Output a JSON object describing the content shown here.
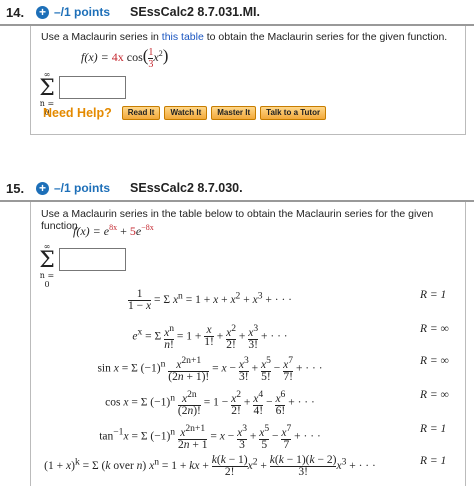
{
  "q14": {
    "number": "14.",
    "points": "–/1 points",
    "id": "SEssCalc2 8.7.031.MI.",
    "prompt_before": "Use a Maclaurin series in ",
    "prompt_link": "this table",
    "prompt_after": " to obtain the Maclaurin series for the given function.",
    "func_lhs": "f(x) = ",
    "func_red": "4x",
    "func_rest": " cos",
    "frac_num": "1",
    "frac_den": "3",
    "exp_var": "x",
    "exp_pow": "2",
    "sum_top": "∞",
    "sum_sym": "Σ",
    "sum_bottom": "n = 0",
    "need_help": "Need Help?",
    "buttons": [
      "Read It",
      "Watch It",
      "Master It",
      "Talk to a Tutor"
    ]
  },
  "q15": {
    "number": "15.",
    "points": "–/1 points",
    "id": "SEssCalc2 8.7.030.",
    "prompt": "Use a Maclaurin series in the table below to obtain the Maclaurin series for the given function.",
    "func_lhs": "f(x) = e",
    "exp1": "8x",
    "plus": " + ",
    "coef": "5",
    "e2": "e",
    "exp2": "−8x",
    "sum_top": "∞",
    "sum_sym": "Σ",
    "sum_bottom": "n = 0"
  },
  "table": {
    "rows": [
      {
        "r": "R = 1"
      },
      {
        "r": "R = ∞"
      },
      {
        "r": "R = ∞"
      },
      {
        "r": "R = ∞"
      },
      {
        "r": "R = 1"
      },
      {
        "r": "R = 1"
      }
    ]
  },
  "colors": {
    "accent": "#1d6fb8",
    "red": "#c4262e",
    "help": "#e48a00",
    "link": "#1a55c0"
  }
}
